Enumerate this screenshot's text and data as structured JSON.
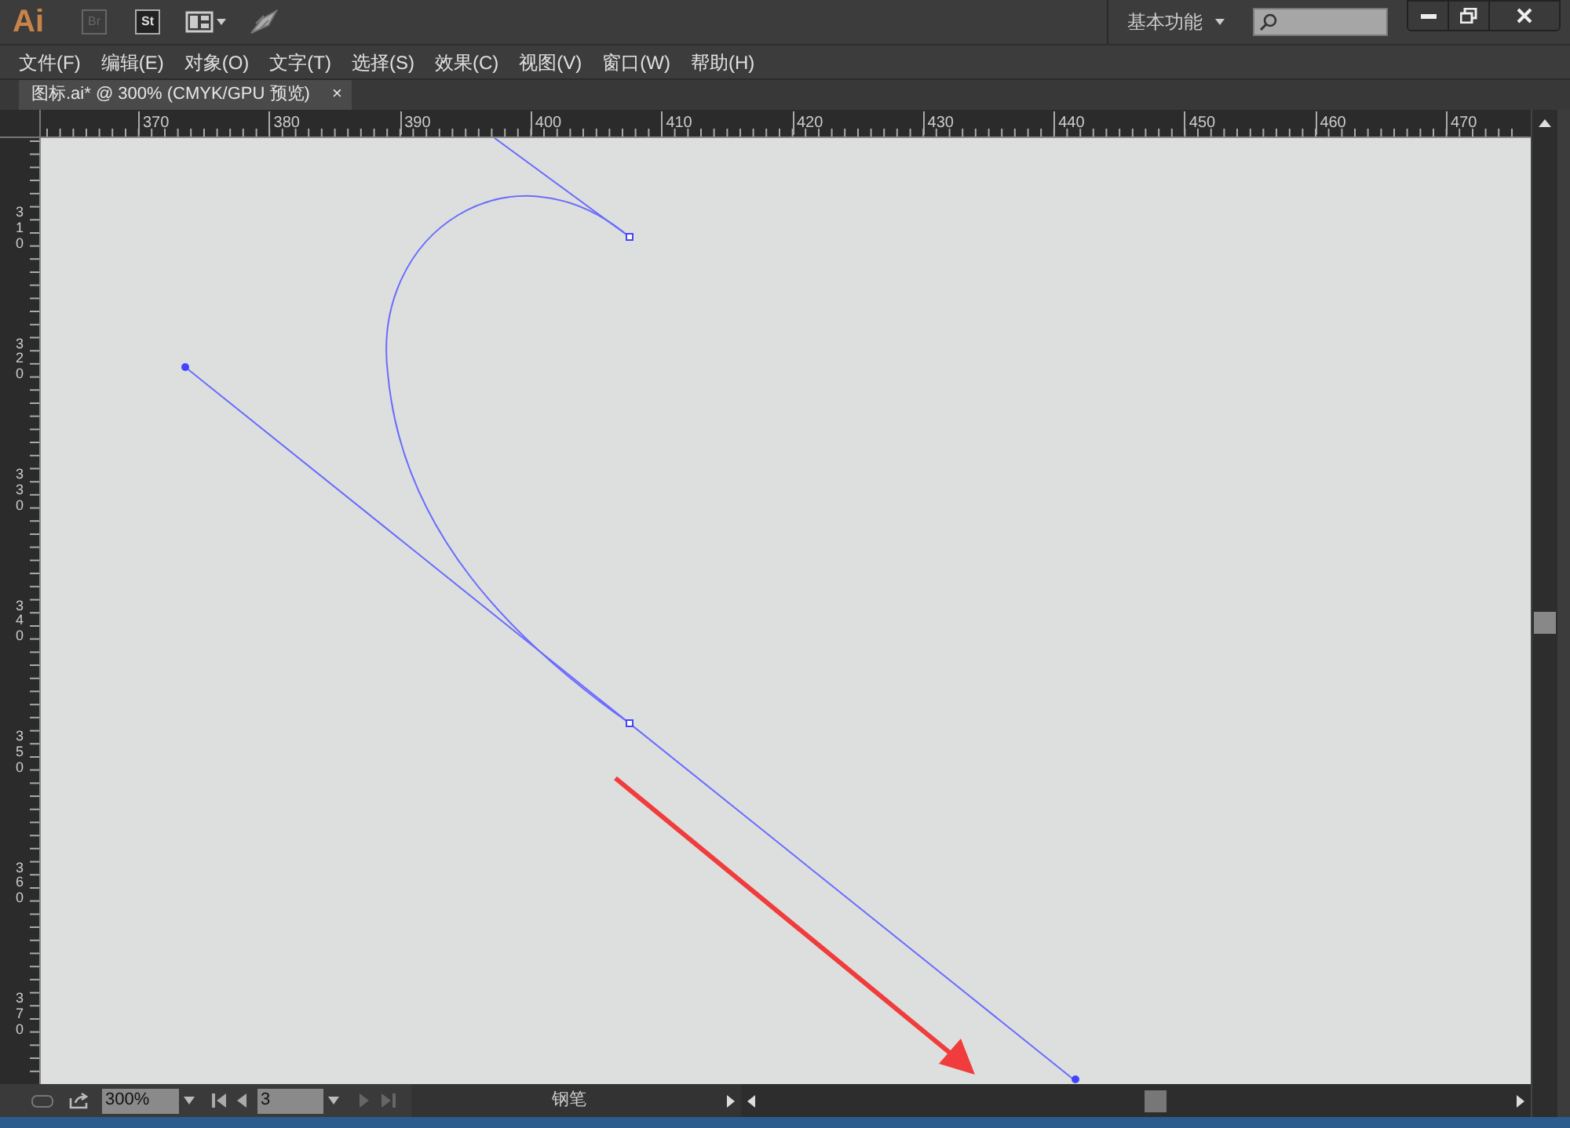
{
  "app": {
    "logo": "Ai",
    "bridge_label": "Br",
    "stock_label": "St",
    "workspace": "基本功能"
  },
  "menu": [
    "文件(F)",
    "编辑(E)",
    "对象(O)",
    "文字(T)",
    "选择(S)",
    "效果(C)",
    "视图(V)",
    "窗口(W)",
    "帮助(H)"
  ],
  "tabs": [
    {
      "label": "图标.ai* @ 300% (CMYK/GPU 预览)",
      "selected": true,
      "close": "×"
    }
  ],
  "ruler_h": [
    "370",
    "380",
    "390",
    "400",
    "410",
    "420",
    "430",
    "440",
    "450",
    "460",
    "470"
  ],
  "ruler_v": [
    "310",
    "320",
    "330",
    "340",
    "350",
    "360",
    "370"
  ],
  "status_bar": {
    "zoom": "300%",
    "artboard": "3",
    "tool": "钢笔"
  }
}
